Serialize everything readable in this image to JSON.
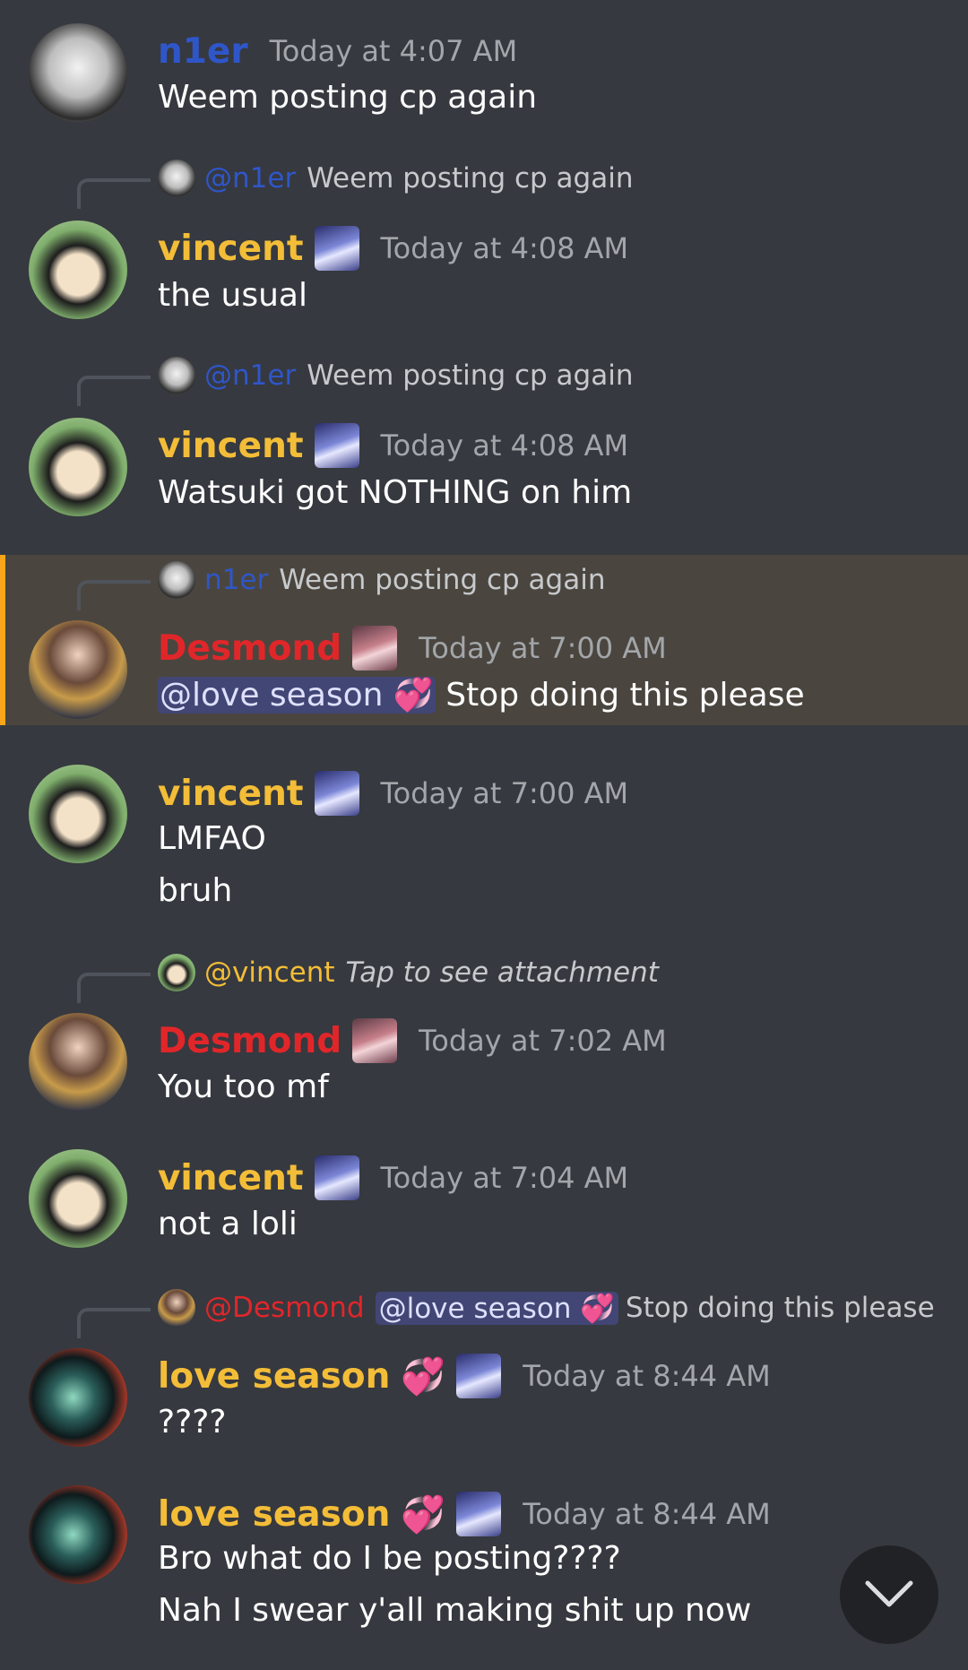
{
  "colors": {
    "background": "#36393f",
    "n1er": "#2f56c9",
    "vincent": "#f3bd38",
    "desmond": "#e1262a",
    "love_season": "#f3bd38",
    "highlight_bar": "#faa61a"
  },
  "messages": [
    {
      "author": "n1er",
      "time": "Today at 4:07 AM",
      "lines": [
        "Weem posting cp again"
      ]
    },
    {
      "reply": {
        "name": "@n1er",
        "text": "Weem posting cp again"
      },
      "author": "vincent",
      "time": "Today at 4:08 AM",
      "lines": [
        "the usual"
      ]
    },
    {
      "reply": {
        "name": "@n1er",
        "text": "Weem posting cp again"
      },
      "author": "vincent",
      "time": "Today at 4:08 AM",
      "lines": [
        "Watsuki got NOTHING on him"
      ]
    },
    {
      "reply": {
        "name": "n1er",
        "text": "Weem posting cp again"
      },
      "author": "Desmond",
      "time": "Today at 7:00 AM",
      "mention": "@love season 💞",
      "lines": [
        "Stop doing this please"
      ],
      "highlighted": true
    },
    {
      "author": "vincent",
      "time": "Today at 7:00 AM",
      "lines": [
        "LMFAO",
        "bruh"
      ]
    },
    {
      "reply": {
        "name": "@vincent",
        "text": "Tap to see attachment"
      },
      "author": "Desmond",
      "time": "Today at 7:02 AM",
      "lines": [
        "You too mf"
      ]
    },
    {
      "author": "vincent",
      "time": "Today at 7:04 AM",
      "lines": [
        "not a loli"
      ]
    },
    {
      "reply": {
        "name": "@Desmond",
        "mention": "@love season 💞",
        "text": "Stop doing this please"
      },
      "author": "love season",
      "time": "Today at 8:44 AM",
      "lines": [
        "????"
      ]
    },
    {
      "author": "love season",
      "time": "Today at 8:44 AM",
      "lines": [
        "Bro what do I be posting????",
        "Nah I swear y'all making shit up now"
      ]
    }
  ],
  "emoji": {
    "heart": "💞"
  },
  "scroll_button": {
    "icon": "chevron-down-icon"
  }
}
